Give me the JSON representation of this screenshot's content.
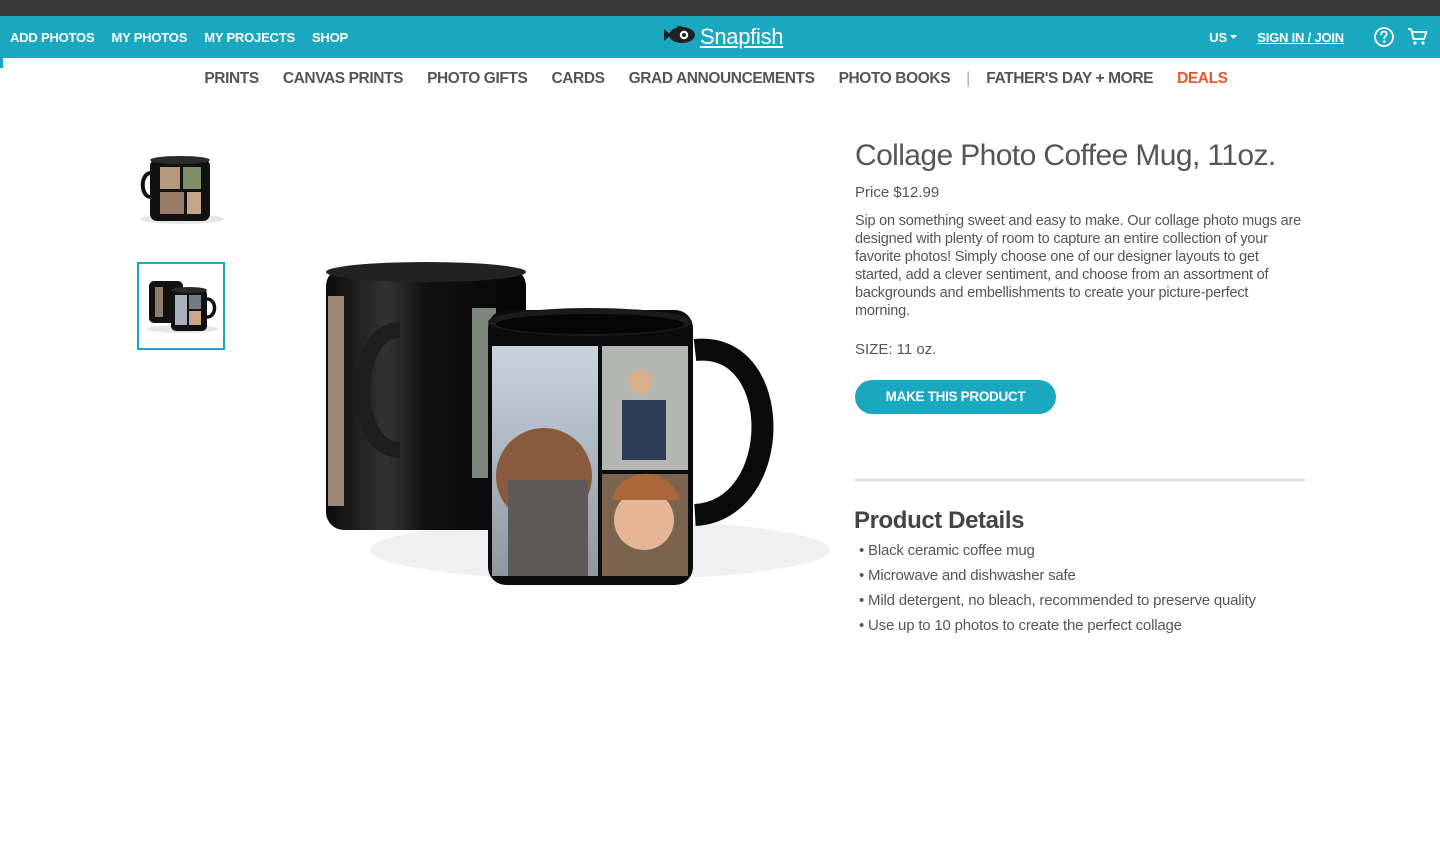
{
  "header": {
    "nav": [
      "ADD PHOTOS",
      "MY PHOTOS",
      "MY PROJECTS",
      "SHOP"
    ],
    "brand": "Snapfish",
    "region": "US",
    "sign_in": "SIGN IN / JOIN",
    "help_icon": "help-icon",
    "cart_icon": "cart-icon",
    "accent_color": "#1aa7c0"
  },
  "categories": {
    "items": [
      "PRINTS",
      "CANVAS PRINTS",
      "PHOTO GIFTS",
      "CARDS",
      "GRAD ANNOUNCEMENTS",
      "PHOTO BOOKS"
    ],
    "separator": "|",
    "extra": "FATHER'S DAY + MORE",
    "deals": "DEALS",
    "deals_color": "#e8572a"
  },
  "product": {
    "title": "Collage Photo Coffee Mug, 11oz.",
    "price": "Price $12.99",
    "description": "Sip on something sweet and easy to make. Our collage photo mugs are designed with plenty of room to capture an entire collection of your favorite photos! Simply choose one of our designer layouts to get started, add a clever sentiment, and choose from an assortment of backgrounds and embellishments to create your picture-perfect morning.",
    "size": "SIZE: 11 oz.",
    "cta": "MAKE THIS PRODUCT"
  },
  "details": {
    "title": "Product Details",
    "bullets": [
      "• Black ceramic coffee mug",
      "• Microwave and dishwasher safe",
      "• Mild detergent, no bleach, recommended to preserve quality",
      "• Use up to 10 photos to create the perfect collage"
    ]
  }
}
